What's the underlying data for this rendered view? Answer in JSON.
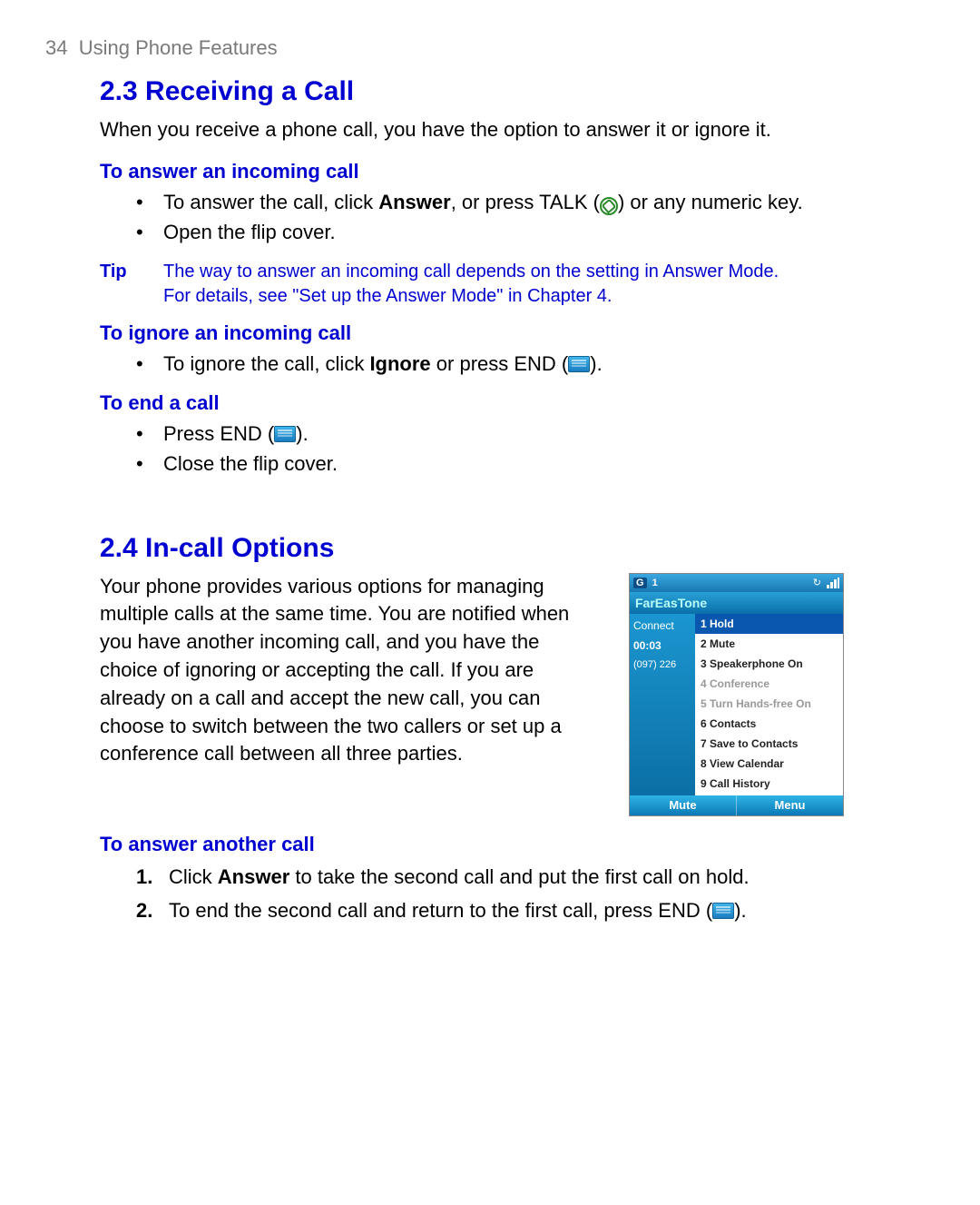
{
  "header": {
    "page_num": "34",
    "chapter": "Using Phone Features"
  },
  "s23": {
    "title": "2.3 Receiving a Call",
    "intro": "When you receive a phone call, you have the option to answer it or ignore it.",
    "answer": {
      "head": "To answer an incoming call",
      "b1_pre": "To answer the call, click ",
      "b1_bold": "Answer",
      "b1_mid": ", or press TALK (",
      "b1_post": ") or any numeric key.",
      "b2": "Open the flip cover."
    },
    "tip": {
      "label": "Tip",
      "text": "The way to answer an incoming call depends on the setting in Answer Mode. For details, see \"Set up the Answer Mode\" in Chapter 4."
    },
    "ignore": {
      "head": "To ignore an incoming call",
      "b1_pre": "To ignore the call, click ",
      "b1_bold": "Ignore",
      "b1_mid": " or press END (",
      "b1_post": ")."
    },
    "end": {
      "head": "To end a call",
      "b1_pre": "Press END (",
      "b1_post": ").",
      "b2": "Close the flip cover."
    }
  },
  "s24": {
    "title": "2.4 In-call Options",
    "intro": "Your phone provides various options for managing multiple calls at the same time. You are notified when you have another incoming call, and you have the choice of ignoring or accepting the call. If you are already on a call and accept the new call, you can choose to switch between the two callers or set up a conference call between all three parties.",
    "screen": {
      "top_g": "G",
      "top_1": "1",
      "carrier": "FarEasTone",
      "status": "Connect",
      "timer": "00:03",
      "number": "(097) 226",
      "menu": [
        "1 Hold",
        "2 Mute",
        "3 Speakerphone On",
        "4 Conference",
        "5 Turn Hands-free On",
        "6 Contacts",
        "7 Save to Contacts",
        "8 View Calendar",
        "9 Call History"
      ],
      "sk_left": "Mute",
      "sk_right": "Menu"
    },
    "answer_another": {
      "head": "To answer another call",
      "n1_pre": "Click ",
      "n1_bold": "Answer",
      "n1_post": " to take the second call and put the first call on hold.",
      "n2_pre": "To end the second call and return to the first call, press END (",
      "n2_post": ")."
    }
  }
}
